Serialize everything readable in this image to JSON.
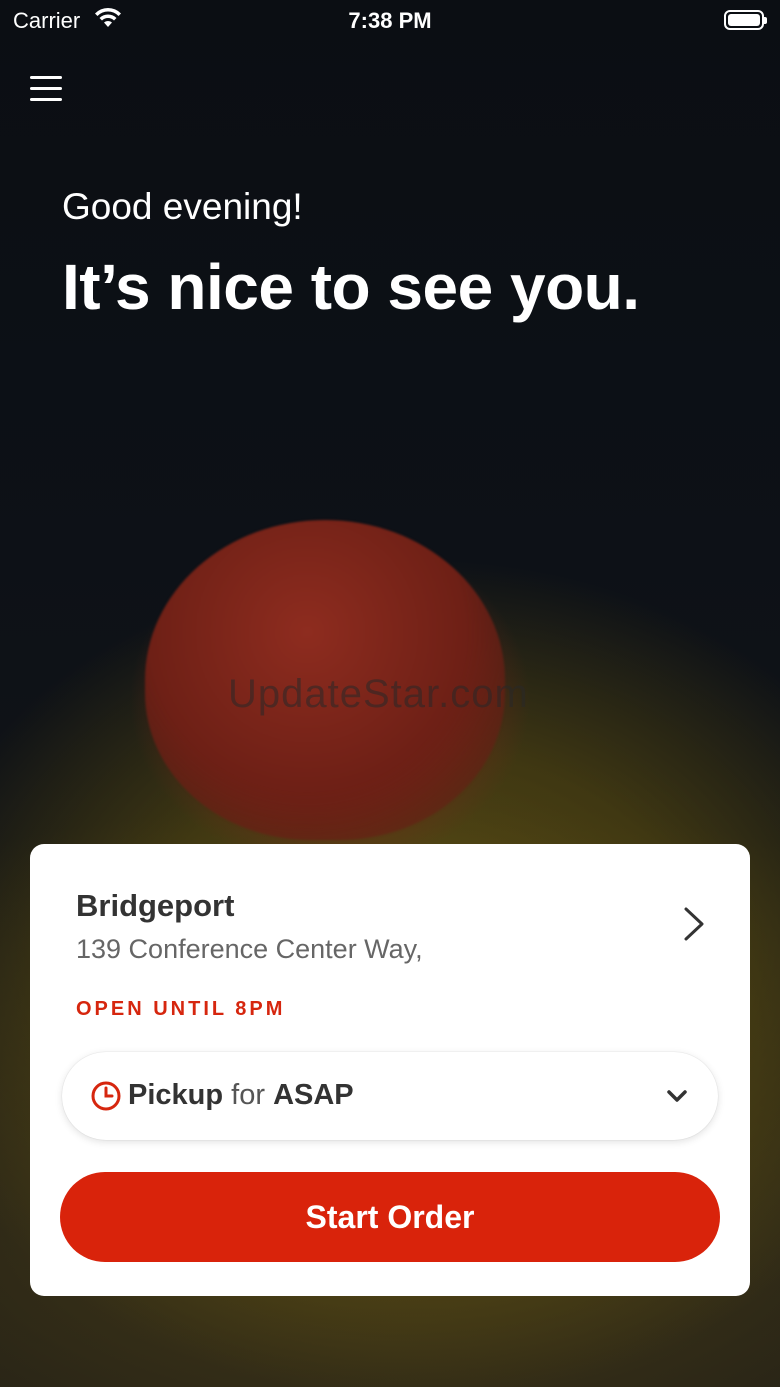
{
  "status_bar": {
    "carrier": "Carrier",
    "time": "7:38 PM"
  },
  "header": {
    "greeting": "Good evening!",
    "headline": "It’s nice to see you."
  },
  "watermark": "UpdateStar.com",
  "location_card": {
    "store_name": "Bridgeport",
    "address": "139 Conference Center Way,",
    "open_status": "OPEN UNTIL 8PM",
    "order_mode": {
      "mode": "Pickup",
      "connector": "for",
      "time": "ASAP"
    },
    "start_button": "Start Order"
  },
  "colors": {
    "accent_red": "#d9230b",
    "open_status_red": "#d6260e",
    "background": "#0c0f14"
  }
}
